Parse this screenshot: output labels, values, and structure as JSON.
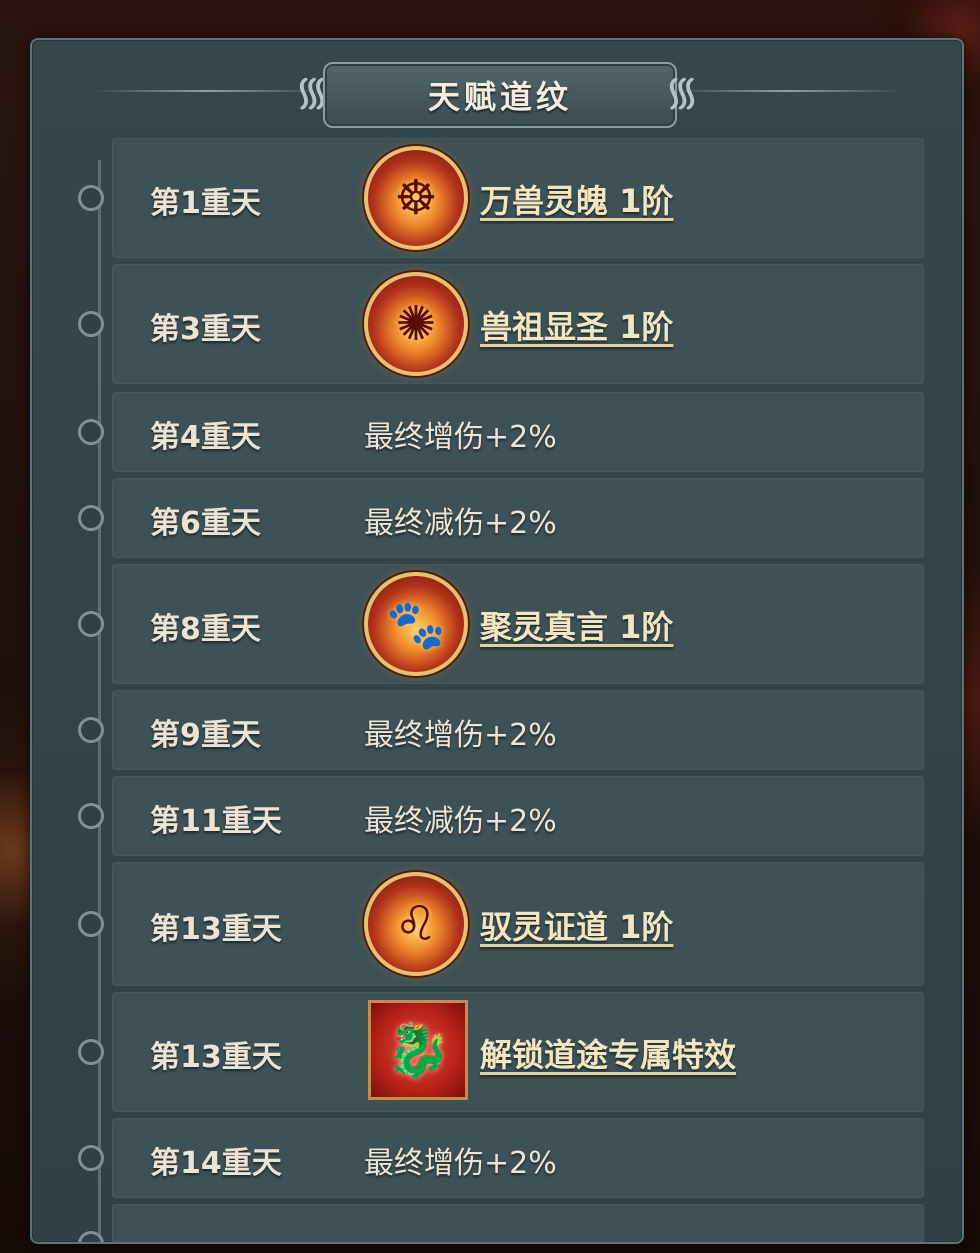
{
  "panel": {
    "title": "天赋道纹"
  },
  "rows": [
    {
      "stage": "第1重天",
      "type": "skill",
      "icon": "beast-soul-icon",
      "reward": "万兽灵魄 1阶"
    },
    {
      "stage": "第3重天",
      "type": "skill",
      "icon": "beast-ancestor-icon",
      "reward": "兽祖显圣 1阶"
    },
    {
      "stage": "第4重天",
      "type": "stat",
      "reward": "最终增伤+2%"
    },
    {
      "stage": "第6重天",
      "type": "stat",
      "reward": "最终减伤+2%"
    },
    {
      "stage": "第8重天",
      "type": "skill",
      "icon": "paw-print-icon",
      "reward": "聚灵真言 1阶"
    },
    {
      "stage": "第9重天",
      "type": "stat",
      "reward": "最终增伤+2%"
    },
    {
      "stage": "第11重天",
      "type": "stat",
      "reward": "最终减伤+2%"
    },
    {
      "stage": "第13重天",
      "type": "skill",
      "icon": "lion-beast-icon",
      "reward": "驭灵证道 1阶"
    },
    {
      "stage": "第13重天",
      "type": "effect",
      "icon": "dragon-effect-icon",
      "reward": "解锁道途专属特效"
    },
    {
      "stage": "第14重天",
      "type": "stat",
      "reward": "最终增伤+2%"
    }
  ]
}
